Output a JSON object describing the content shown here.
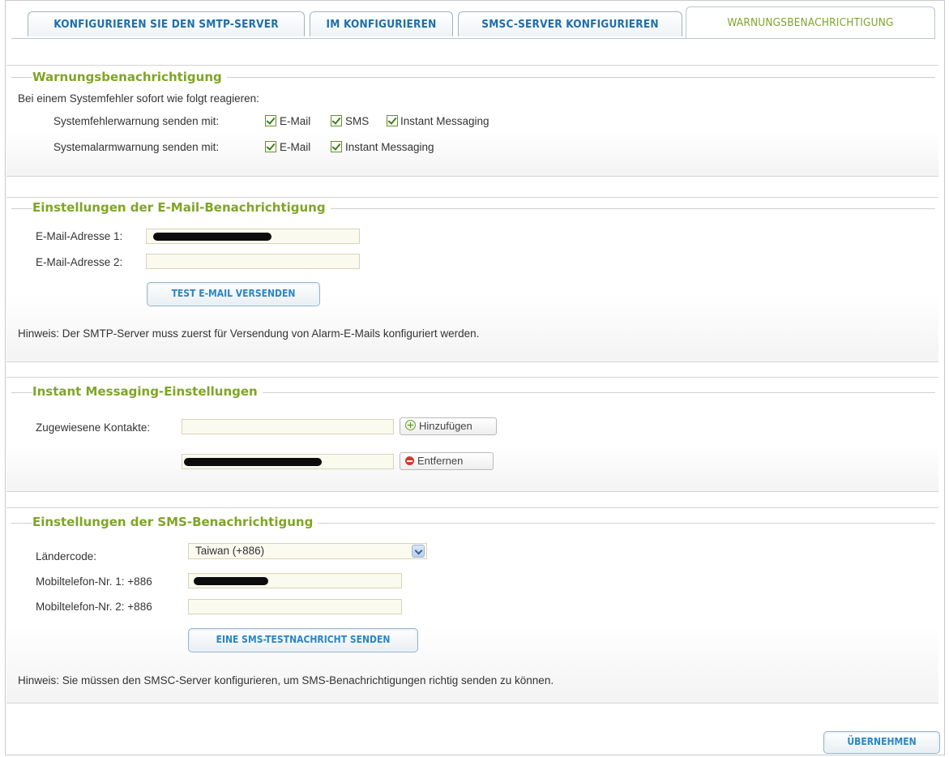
{
  "tabs": [
    {
      "label": "KONFIGURIEREN SIE DEN SMTP-SERVER",
      "active": false
    },
    {
      "label": "IM KONFIGURIEREN",
      "active": false
    },
    {
      "label": "SMSC-SERVER KONFIGURIEREN",
      "active": false
    },
    {
      "label": "WARNUNGSBENACHRICHTIGUNG",
      "active": true
    }
  ],
  "alert": {
    "title": "Warnungsbenachrichtigung",
    "intro": "Bei einem Systemfehler sofort wie folgt reagieren:",
    "error_label": "Systemfehlerwarnung senden mit:",
    "error_options": [
      "E-Mail",
      "SMS",
      "Instant Messaging"
    ],
    "alarm_label": "Systemalarmwarnung senden mit:",
    "alarm_options": [
      "E-Mail",
      "Instant Messaging"
    ]
  },
  "email": {
    "title": "Einstellungen der E-Mail-Benachrichtigung",
    "address1_label": "E-Mail-Adresse 1:",
    "address2_label": "E-Mail-Adresse 2:",
    "address2_value": "",
    "test_button": "TEST E-MAIL VERSENDEN",
    "note": "Hinweis: Der SMTP-Server muss zuerst für Versendung von Alarm-E-Mails konfiguriert werden."
  },
  "im": {
    "title": "Instant Messaging-Einstellungen",
    "contacts_label": "Zugewiesene Kontakte:",
    "add_button": "Hinzufügen",
    "remove_button": "Entfernen"
  },
  "sms": {
    "title": "Einstellungen der SMS-Benachrichtigung",
    "country_label": "Ländercode:",
    "country_value": "Taiwan (+886)",
    "phone1_label": "Mobiltelefon-Nr. 1: +886",
    "phone2_label": "Mobiltelefon-Nr. 2: +886",
    "test_button": "EINE SMS-TESTNACHRICHT SENDEN",
    "note": "Hinweis: Sie müssen den SMSC-Server konfigurieren, um SMS-Benachrichtigungen richtig senden zu können."
  },
  "apply_button": "ÜBERNEHMEN",
  "colors": {
    "accent_green": "#7fa428",
    "link_blue": "#2a86c6",
    "tab_blue": "#1d6fa9"
  }
}
